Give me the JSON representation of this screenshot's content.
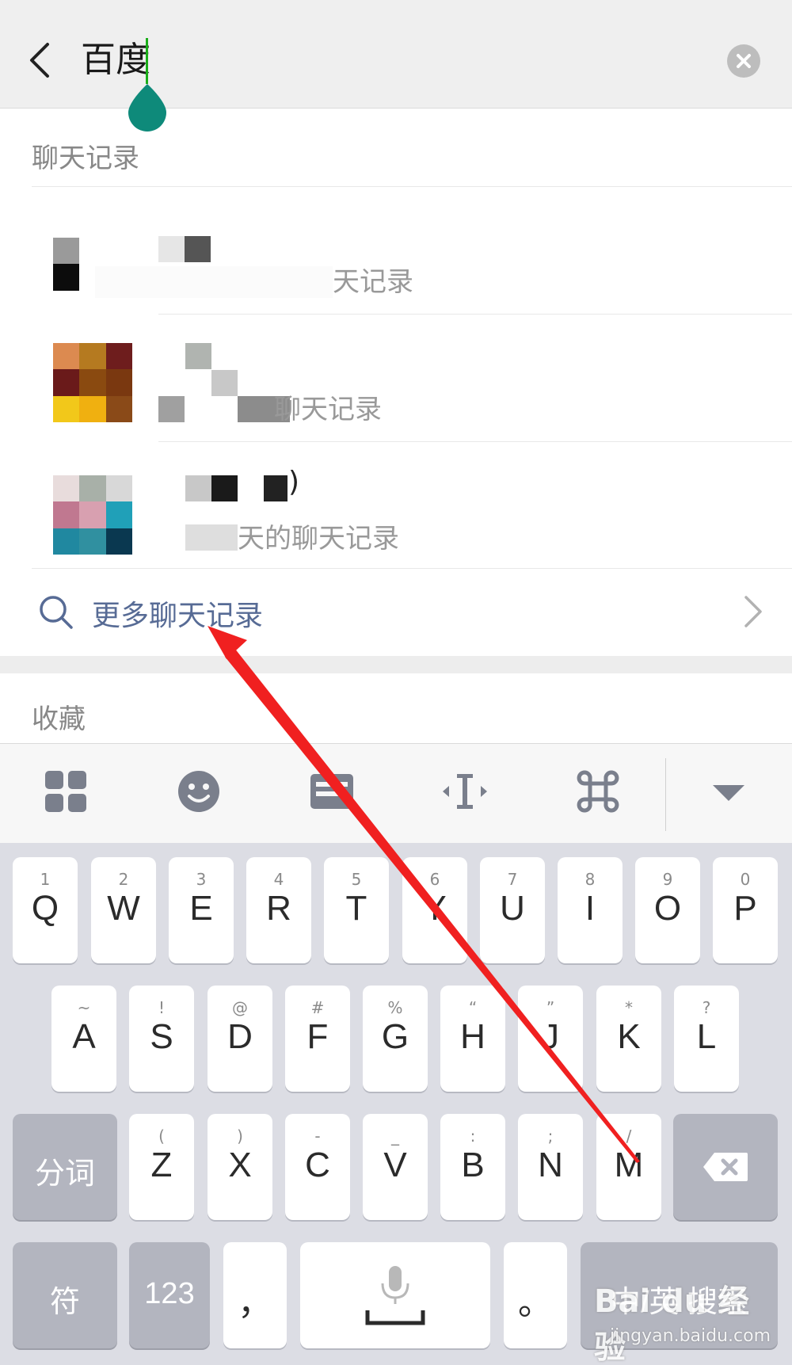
{
  "search": {
    "query": "百度"
  },
  "sections": {
    "chat_title": "聊天记录",
    "favorites_title": "收藏"
  },
  "results": [
    {
      "name": "",
      "subtitle": "天记录"
    },
    {
      "name": "",
      "subtitle": "聊天记录"
    },
    {
      "name": ")",
      "subtitle": "天的聊天记录"
    }
  ],
  "more": {
    "label": "更多聊天记录"
  },
  "toolbar": {
    "icons": [
      "grid-icon",
      "emoji-icon",
      "clipboard-icon",
      "cursor-icon",
      "command-icon",
      "collapse-icon"
    ]
  },
  "keyboard": {
    "row1": [
      {
        "main": "Q",
        "sup": "1"
      },
      {
        "main": "W",
        "sup": "2"
      },
      {
        "main": "E",
        "sup": "3"
      },
      {
        "main": "R",
        "sup": "4"
      },
      {
        "main": "T",
        "sup": "5"
      },
      {
        "main": "Y",
        "sup": "6"
      },
      {
        "main": "U",
        "sup": "7"
      },
      {
        "main": "I",
        "sup": "8"
      },
      {
        "main": "O",
        "sup": "9"
      },
      {
        "main": "P",
        "sup": "0"
      }
    ],
    "row2": [
      {
        "main": "A",
        "sup": "~"
      },
      {
        "main": "S",
        "sup": "!"
      },
      {
        "main": "D",
        "sup": "@"
      },
      {
        "main": "F",
        "sup": "#"
      },
      {
        "main": "G",
        "sup": "%"
      },
      {
        "main": "H",
        "sup": "“"
      },
      {
        "main": "J",
        "sup": "”"
      },
      {
        "main": "K",
        "sup": "*"
      },
      {
        "main": "L",
        "sup": "?"
      }
    ],
    "row3": [
      {
        "main": "Z",
        "sup": "("
      },
      {
        "main": "X",
        "sup": ")"
      },
      {
        "main": "C",
        "sup": "-"
      },
      {
        "main": "V",
        "sup": "_"
      },
      {
        "main": "B",
        "sup": ":"
      },
      {
        "main": "N",
        "sup": ";"
      },
      {
        "main": "M",
        "sup": "/"
      }
    ],
    "segment": "分词",
    "symbols": "符",
    "numbers": "123",
    "comma": "，",
    "period": "。",
    "search_key": "中/英 搜索"
  },
  "watermark": {
    "logo": "Bai du 经验",
    "url": "jingyan.baidu.com"
  },
  "colors": {
    "accent_green": "#1aad19",
    "caret_handle": "#0e8a7a",
    "link_blue": "#576b95",
    "arrow_red": "#f02020"
  }
}
